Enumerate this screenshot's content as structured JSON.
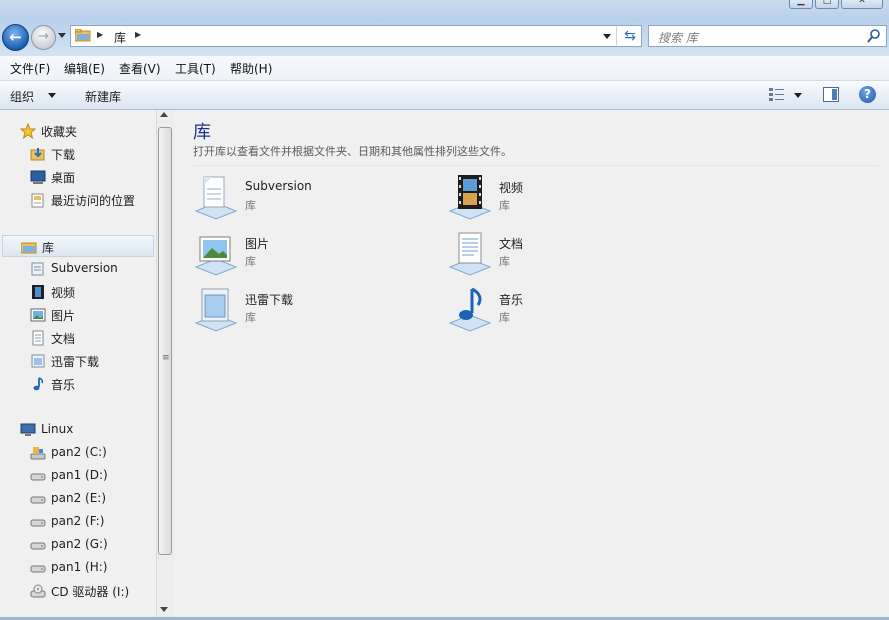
{
  "address": {
    "crumb": "库"
  },
  "search": {
    "placeholder": "搜索 库"
  },
  "menu": {
    "file": "文件(F)",
    "edit": "编辑(E)",
    "view": "查看(V)",
    "tools": "工具(T)",
    "help": "帮助(H)"
  },
  "toolbar": {
    "organize": "组织",
    "new_library": "新建库"
  },
  "nav": {
    "favorites": {
      "header": "收藏夹",
      "items": [
        "下载",
        "桌面",
        "最近访问的位置"
      ]
    },
    "libraries": {
      "header": "库",
      "items": [
        "Subversion",
        "视频",
        "图片",
        "文档",
        "迅雷下载",
        "音乐"
      ]
    },
    "computer": {
      "header": "Linux",
      "drives": [
        "pan2 (C:)",
        "pan1 (D:)",
        "pan2 (E:)",
        "pan2 (F:)",
        "pan2 (G:)",
        "pan1 (H:)",
        "CD 驱动器 (I:)"
      ]
    }
  },
  "main": {
    "title": "库",
    "description": "打开库以查看文件并根据文件夹、日期和其他属性排列这些文件。",
    "items": [
      {
        "name": "Subversion",
        "type": "库",
        "icon": "subversion-library-icon"
      },
      {
        "name": "视频",
        "type": "库",
        "icon": "video-library-icon"
      },
      {
        "name": "图片",
        "type": "库",
        "icon": "pictures-library-icon"
      },
      {
        "name": "文档",
        "type": "库",
        "icon": "documents-library-icon"
      },
      {
        "name": "迅雷下载",
        "type": "库",
        "icon": "xunlei-library-icon"
      },
      {
        "name": "音乐",
        "type": "库",
        "icon": "music-library-icon"
      }
    ]
  },
  "colors": {
    "accent": "#1e3287",
    "titlebar": "#c9dcee",
    "selection": "#dde7f2"
  }
}
